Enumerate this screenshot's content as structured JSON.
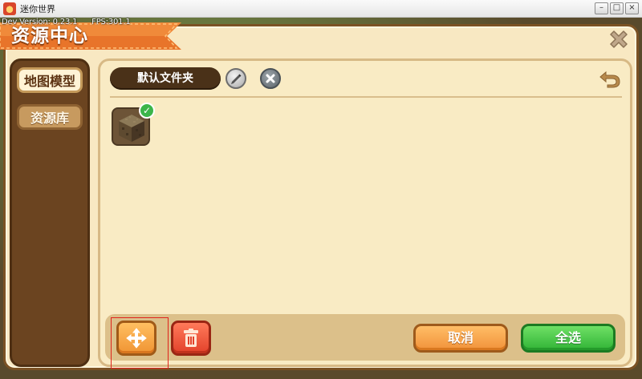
{
  "window": {
    "title": "迷你世界",
    "minimize_label": "–",
    "maximize_label": "□",
    "close_label": "×"
  },
  "dev_overlay": {
    "version": "Dev Version: 0.23.1",
    "fps": "FPS:301.1"
  },
  "header": {
    "title": "资源中心"
  },
  "sidebar": {
    "tabs": [
      {
        "label": "地图模型",
        "active": true
      },
      {
        "label": "资源库",
        "active": false
      }
    ]
  },
  "content": {
    "folder_name": "默认文件夹",
    "items": [
      {
        "icon": "dirt-block-icon",
        "selected": true
      }
    ]
  },
  "bottom_bar": {
    "cancel_label": "取消",
    "select_all_label": "全选"
  },
  "colors": {
    "accent_orange": "#f09433",
    "accent_green": "#30b336",
    "panel_bg": "#f8e8c2",
    "sidebar_brown": "#6b4420"
  }
}
